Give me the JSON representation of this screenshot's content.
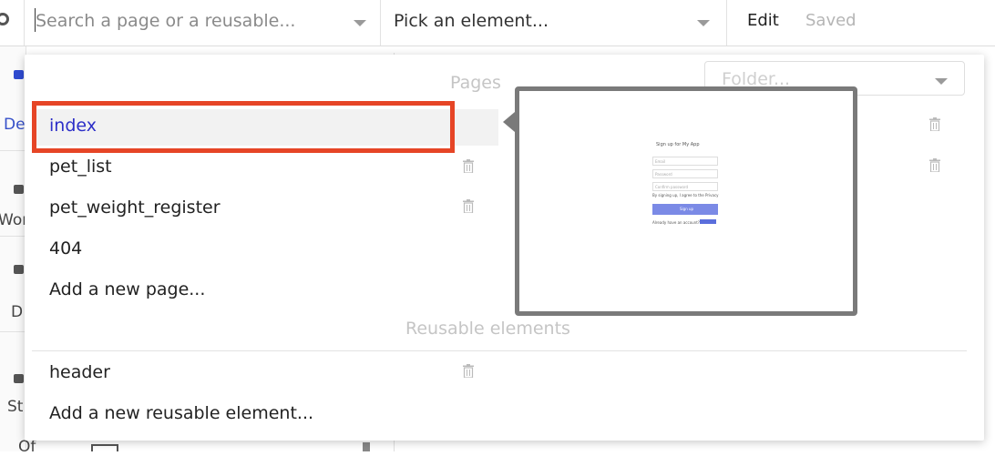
{
  "topbar": {
    "search_placeholder": "Search a page or a reusable...",
    "element_picker": "Pick an element...",
    "edit_label": "Edit",
    "saved_label": "Saved"
  },
  "sidebar": {
    "labels": [
      "De",
      "Wor",
      "D",
      "St",
      "Of"
    ]
  },
  "dropdown": {
    "pages_title": "Pages",
    "folder_placeholder": "Folder...",
    "pages": [
      "index",
      "pet_list",
      "pet_weight_register",
      "404"
    ],
    "add_page": "Add a new page...",
    "reusable_title": "Reusable elements",
    "reusables": [
      "header"
    ],
    "add_reusable": "Add a new reusable element...",
    "selected": "index"
  },
  "preview": {
    "title": "Sign up for My App",
    "fields": [
      "Email",
      "Password",
      "Confirm password"
    ],
    "terms": "By signing up, I agree to the Privacy",
    "button": "Sign up",
    "footer": "Already have an account?"
  },
  "colors": {
    "selection_outline": "#e64526",
    "selected_text": "#2d2fc8",
    "preview_button": "#7b8ae6"
  }
}
